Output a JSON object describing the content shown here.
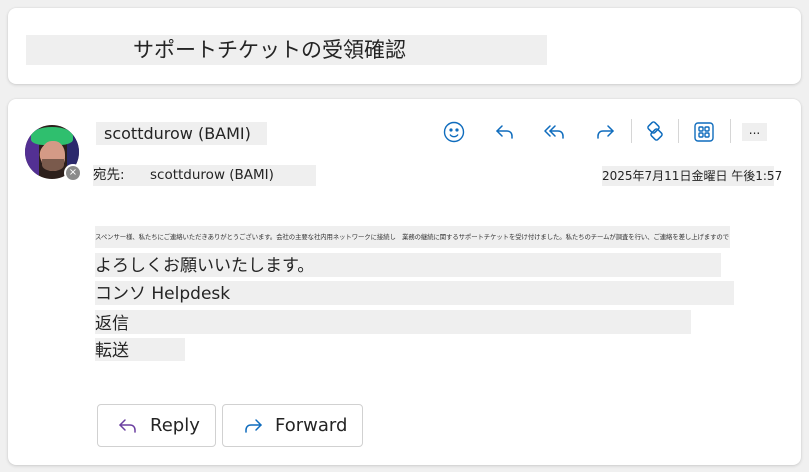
{
  "subject": "サポートチケットの受領確認",
  "sender": {
    "name": "scottdurow (BAMI)"
  },
  "to": {
    "label": "宛先:",
    "name": "scottdurow (BAMI)"
  },
  "date": "2025年7月11日金曜日 午後1:57",
  "toolbar": {
    "more_label": "..."
  },
  "body": {
    "intro": "スペンサー様、私たちにご連絡いただきありがとうございます。会社の主要な社内用ネットワークに接続し　業務の継続に関するサポートチケットを受け付けました。私たちのチームが調査を行い、ご連絡を差し上げますのでしばらくお待ちください。",
    "closing": "よろしくお願いいたします。",
    "signature": "コンソ Helpdesk",
    "reply_link": "返信",
    "forward_link": "転送"
  },
  "actions": {
    "reply_label": "Reply",
    "forward_label": "Forward"
  },
  "colors": {
    "accent": "#0f6cbd",
    "highlight": "#efefef"
  }
}
